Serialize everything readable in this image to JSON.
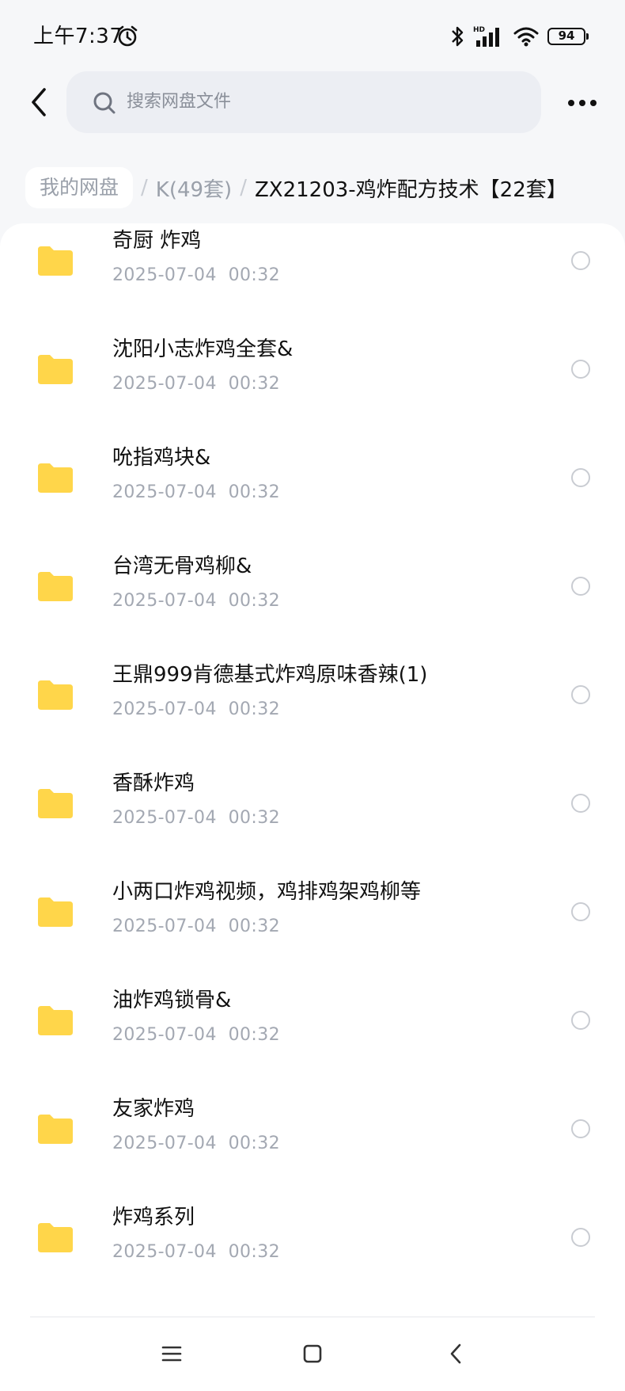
{
  "status_bar": {
    "time": "上午7:37",
    "battery": "94",
    "icons": [
      "alarm-icon",
      "bluetooth-icon",
      "hd-signal-icon",
      "wifi-icon",
      "battery-icon"
    ]
  },
  "header": {
    "search_placeholder": "搜索网盘文件",
    "icons": [
      "back-arrow-icon",
      "search-icon",
      "more-icon"
    ]
  },
  "breadcrumb": {
    "root": "我的网盘",
    "separator": "/",
    "middle": "K(49套)",
    "current": "ZX21203-鸡炸配方技术【22套】"
  },
  "files": [
    {
      "name": "奇厨 炸鸡",
      "date": "2025-07-04  00:32"
    },
    {
      "name": "沈阳小志炸鸡全套&",
      "date": "2025-07-04  00:32"
    },
    {
      "name": "吮指鸡块&",
      "date": "2025-07-04  00:32"
    },
    {
      "name": "台湾无骨鸡柳&",
      "date": "2025-07-04  00:32"
    },
    {
      "name": "王鼎999肯德基式炸鸡原味香辣(1)",
      "date": "2025-07-04  00:32"
    },
    {
      "name": "香酥炸鸡",
      "date": "2025-07-04  00:32"
    },
    {
      "name": "小两口炸鸡视频，鸡排鸡架鸡柳等",
      "date": "2025-07-04  00:32"
    },
    {
      "name": "油炸鸡锁骨&",
      "date": "2025-07-04  00:32"
    },
    {
      "name": "友家炸鸡",
      "date": "2025-07-04  00:32"
    },
    {
      "name": "炸鸡系列",
      "date": "2025-07-04  00:32"
    }
  ],
  "nav_bar": {
    "icons": [
      "menu-icon",
      "home-icon",
      "back-icon"
    ]
  },
  "colors": {
    "folder": "#ffd64a",
    "background": "#f6f7f9",
    "search_bg": "#eceef3",
    "secondary_text": "#a3a8b2"
  }
}
